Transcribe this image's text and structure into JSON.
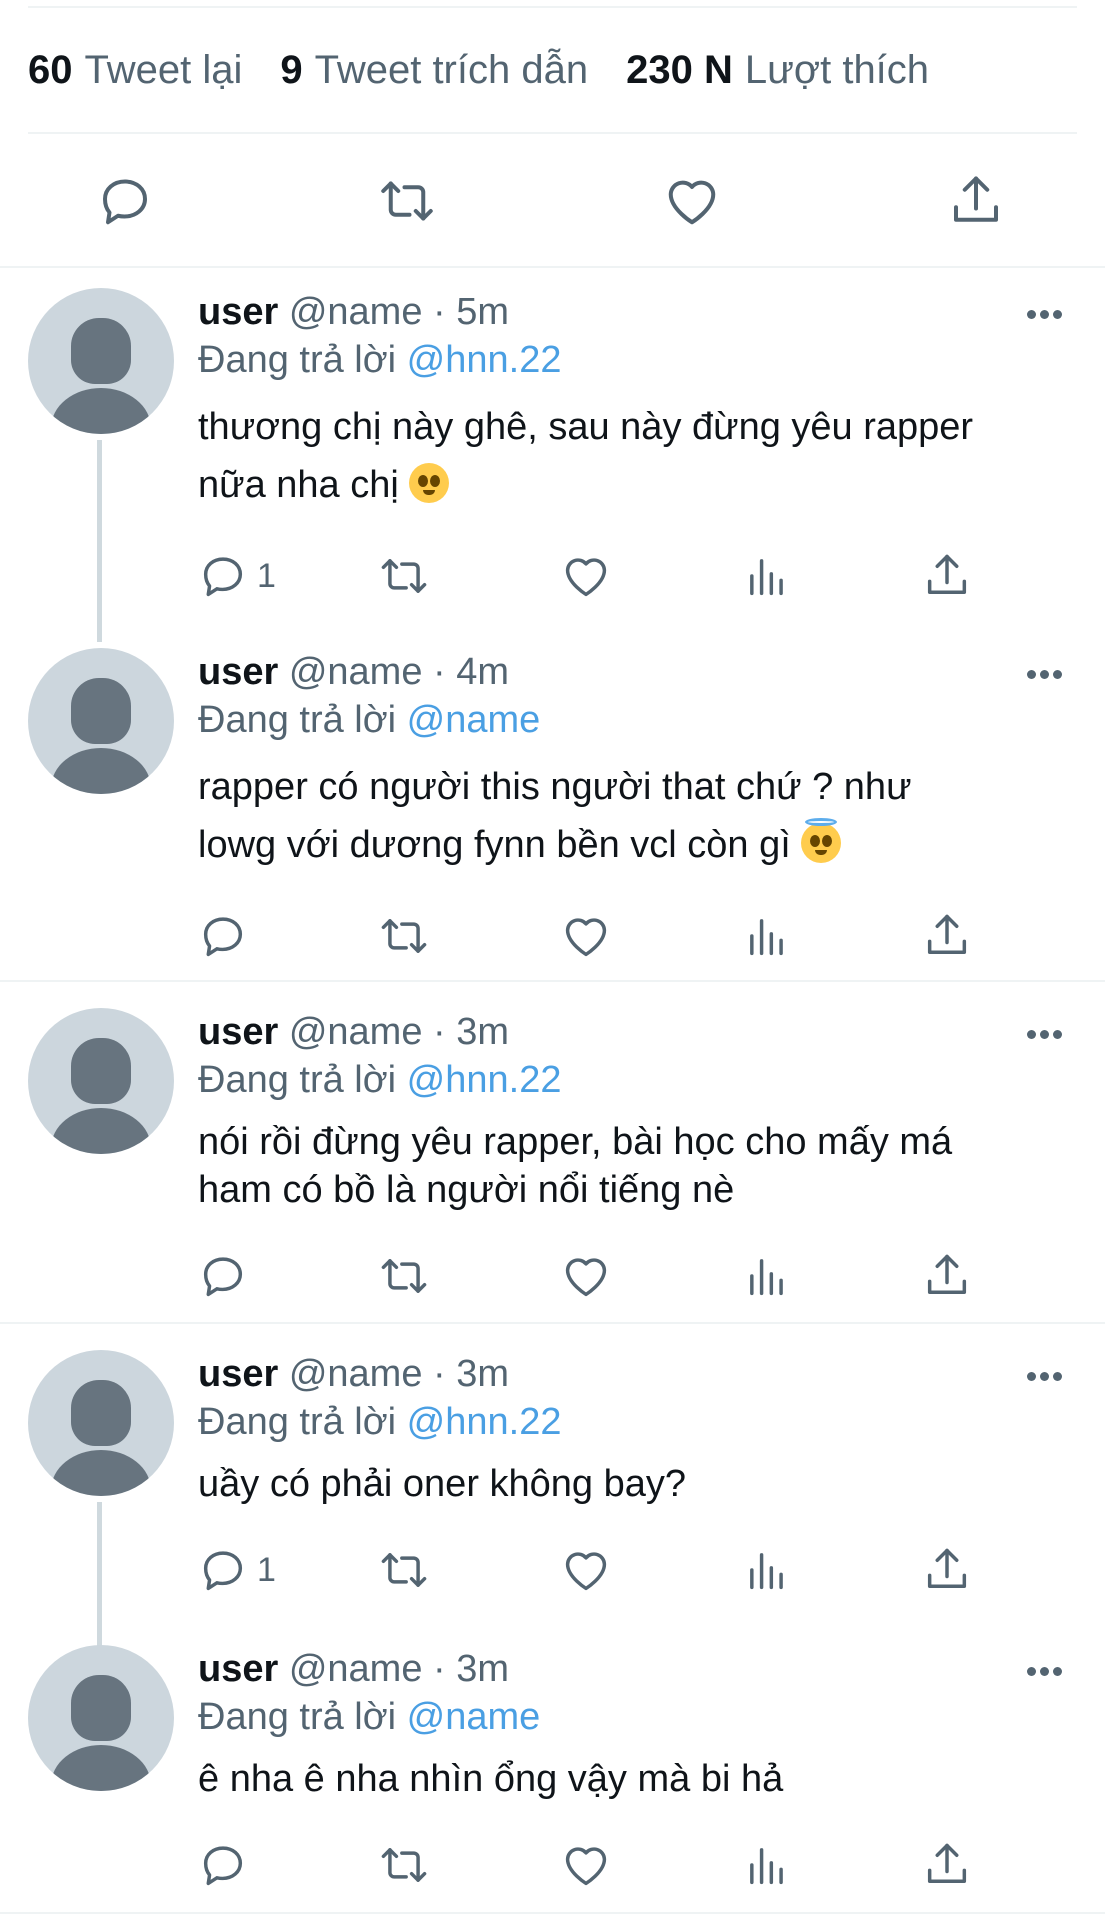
{
  "stats": {
    "retweets_count": "60",
    "retweets_label": "Tweet lại",
    "quotes_count": "9",
    "quotes_label": "Tweet trích dẫn",
    "likes_count": "230 N",
    "likes_label": "Lượt thích"
  },
  "icons": {
    "reply": "reply-icon",
    "retweet": "retweet-icon",
    "like": "heart-icon",
    "share": "share-icon",
    "analytics": "analytics-icon",
    "more": "more-icon"
  },
  "colors": {
    "text": "#0f1419",
    "secondary": "#536471",
    "mention": "#4a9fe3",
    "avatar_bg": "#ccd6dd",
    "avatar_fg": "#67747f",
    "divider": "#eff3f4"
  },
  "replies": [
    {
      "username": "user",
      "handle": "@name",
      "time": "5m",
      "replying_prefix": "Đang trả lời",
      "replying_to": "@hnn.22",
      "text_line1": "thương chị này ghê, sau này đừng yêu rapper",
      "text_line2": "nữa nha chị",
      "reply_count": "1"
    },
    {
      "username": "user",
      "handle": "@name",
      "time": "4m",
      "replying_prefix": "Đang trả lời",
      "replying_to": "@name",
      "text_line1": "rapper có người this người that chứ ? như",
      "text_line2": "lowg với dương fynn bền vcl còn gì",
      "reply_count": ""
    },
    {
      "username": "user",
      "handle": "@name",
      "time": "3m",
      "replying_prefix": "Đang trả lời",
      "replying_to": "@hnn.22",
      "text_line1": "nói rồi đừng yêu rapper, bài học cho mấy má",
      "text_line2": "ham có bồ là người nổi tiếng nè",
      "reply_count": ""
    },
    {
      "username": "user",
      "handle": "@name",
      "time": "3m",
      "replying_prefix": "Đang trả lời",
      "replying_to": "@hnn.22",
      "text_line1": "uầy có phải oner không bay?",
      "text_line2": "",
      "reply_count": "1"
    },
    {
      "username": "user",
      "handle": "@name",
      "time": "3m",
      "replying_prefix": "Đang trả lời",
      "replying_to": "@name",
      "text_line1": "ê nha ê nha nhìn ổng vậy mà bi hả",
      "text_line2": "",
      "reply_count": ""
    }
  ]
}
